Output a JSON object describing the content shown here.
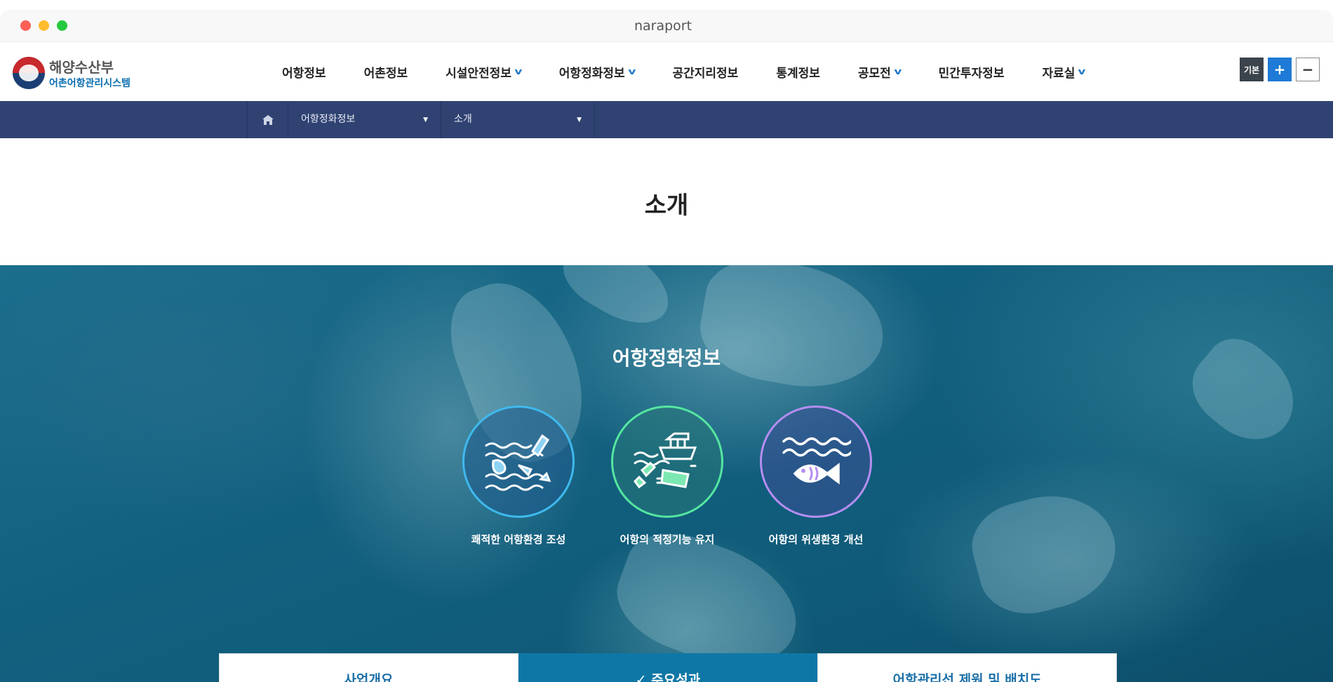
{
  "window": {
    "title": "naraport"
  },
  "logo": {
    "main": "해양수산부",
    "sub": "어촌어항관리시스템"
  },
  "gnb": [
    {
      "label": "어항정보",
      "dropdown": false
    },
    {
      "label": "어촌정보",
      "dropdown": false
    },
    {
      "label": "시설안전정보",
      "dropdown": true
    },
    {
      "label": "어항정화정보",
      "dropdown": true
    },
    {
      "label": "공간지리정보",
      "dropdown": false
    },
    {
      "label": "통계정보",
      "dropdown": false
    },
    {
      "label": "공모전",
      "dropdown": true
    },
    {
      "label": "민간투자정보",
      "dropdown": false
    },
    {
      "label": "자료실",
      "dropdown": true
    }
  ],
  "font_tools": {
    "base": "기본",
    "plus": "+",
    "minus": "−"
  },
  "subnav": {
    "level1": "어항정화정보",
    "level2": "소개"
  },
  "page": {
    "title": "소개"
  },
  "hero": {
    "title": "어항정화정보",
    "features": [
      {
        "label": "쾌적한 어항환경 조성",
        "icon": "waves-bottle-icon",
        "color": "#3fb9ee"
      },
      {
        "label": "어항의 적정기능 유지",
        "icon": "ship-trash-icon",
        "color": "#55e6a0"
      },
      {
        "label": "어항의 위생환경 개선",
        "icon": "waves-fish-icon",
        "color": "#b48ef0"
      }
    ]
  },
  "tabs": [
    {
      "label": "사업개요",
      "active": false
    },
    {
      "label": "✓ 주요성과",
      "active": true
    },
    {
      "label": "어항관리선 제원 및 배치도",
      "active": false
    }
  ]
}
